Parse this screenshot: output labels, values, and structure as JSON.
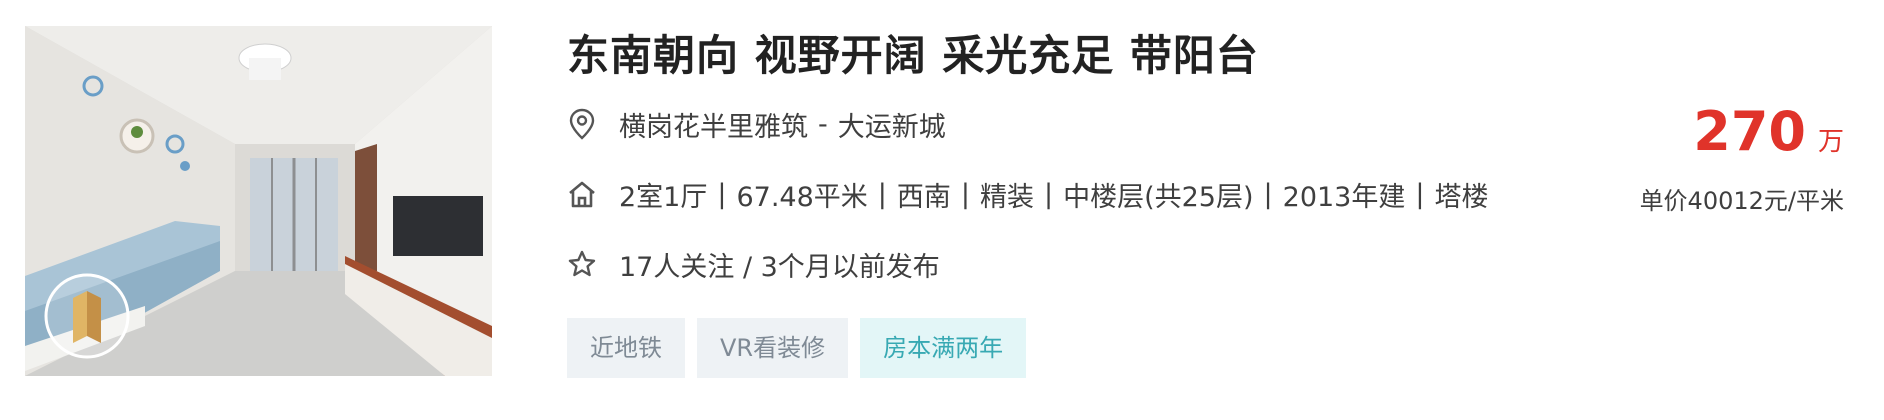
{
  "listing": {
    "title": "东南朝向 视野开阔 采光充足 带阳台",
    "location": {
      "icon": "location-pin-icon",
      "community": "横岗花半里雅筑",
      "separator": "-",
      "district": "大运新城"
    },
    "house_info": {
      "icon": "house-icon",
      "items": [
        "2室1厅",
        "67.48平米",
        "西南",
        "精装",
        "中楼层(共25层)",
        "2013年建",
        "塔楼"
      ],
      "separator": "|"
    },
    "follow_info": {
      "icon": "star-icon",
      "text": "17人关注 / 3个月以前发布"
    },
    "tags": [
      "近地铁",
      "VR看装修",
      "房本满两年"
    ],
    "price": {
      "total": "270",
      "unit": "万",
      "unit_price": "单价40012元/平米"
    },
    "photo": {
      "icon": "vr-icon"
    }
  },
  "colors": {
    "price": "#e0332a",
    "tag_bg": "#eef2f5",
    "tag_text": "#7f8a95",
    "tag_highlight_bg": "#e3f6f7",
    "tag_highlight_text": "#38a9b3"
  }
}
